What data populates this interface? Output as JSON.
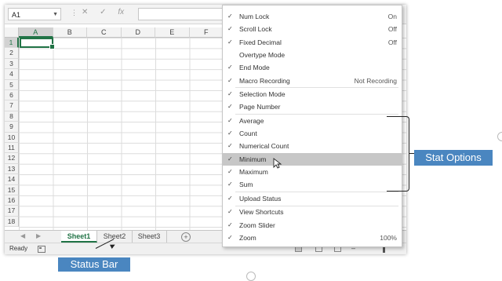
{
  "formula_bar": {
    "name_box": "A1",
    "icons": [
      "cancel-icon",
      "enter-icon",
      "function-icon"
    ],
    "cancel_glyph": "✕",
    "enter_glyph": "✓",
    "fx_glyph": "fx"
  },
  "columns": [
    "A",
    "B",
    "C",
    "D",
    "E",
    "F"
  ],
  "rows": [
    "1",
    "2",
    "3",
    "4",
    "5",
    "6",
    "7",
    "8",
    "9",
    "10",
    "11",
    "12",
    "13",
    "14",
    "15",
    "16",
    "17",
    "18"
  ],
  "active_cell": "A1",
  "sheets": {
    "tabs": [
      "Sheet1",
      "Sheet2",
      "Sheet3"
    ],
    "active": "Sheet1",
    "add_glyph": "+"
  },
  "status_bar": {
    "ready": "Ready",
    "zoom_minus": "–"
  },
  "menu": {
    "items": [
      {
        "label": "Num Lock",
        "checked": true,
        "value": "On"
      },
      {
        "label": "Scroll Lock",
        "checked": true,
        "value": "Off"
      },
      {
        "label": "Fixed Decimal",
        "checked": true,
        "value": "Off"
      },
      {
        "label": "Overtype Mode",
        "checked": false,
        "value": ""
      },
      {
        "label": "End Mode",
        "checked": true,
        "value": ""
      },
      {
        "label": "Macro Recording",
        "checked": true,
        "value": "Not Recording"
      },
      {
        "label": "Selection Mode",
        "checked": true,
        "value": ""
      },
      {
        "label": "Page Number",
        "checked": true,
        "value": ""
      },
      {
        "label": "Average",
        "checked": true,
        "value": ""
      },
      {
        "label": "Count",
        "checked": true,
        "value": ""
      },
      {
        "label": "Numerical Count",
        "checked": true,
        "value": ""
      },
      {
        "label": "Minimum",
        "checked": true,
        "value": ""
      },
      {
        "label": "Maximum",
        "checked": true,
        "value": ""
      },
      {
        "label": "Sum",
        "checked": true,
        "value": ""
      },
      {
        "label": "Upload Status",
        "checked": true,
        "value": ""
      },
      {
        "label": "View Shortcuts",
        "checked": true,
        "value": ""
      },
      {
        "label": "Zoom Slider",
        "checked": true,
        "value": ""
      },
      {
        "label": "Zoom",
        "checked": true,
        "value": "100%"
      }
    ],
    "highlighted": "Minimum",
    "check_glyph": "✓"
  },
  "annotations": {
    "stat_options": "Stat Options",
    "status_bar": "Status Bar"
  },
  "colors": {
    "accent": "#217346",
    "callout": "#4a86c0",
    "highlight": "#c7c7c7"
  }
}
